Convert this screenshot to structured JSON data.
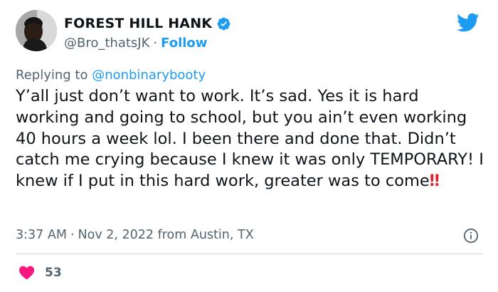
{
  "tweet": {
    "author": {
      "display_name": "FOREST HILL HANK",
      "handle": "@Bro_thatsJK",
      "follow_label": "Follow",
      "separator": "·"
    },
    "reply_prefix": "Replying to",
    "reply_mention": "@nonbinarybooty",
    "text": "Y’all just don’t want to work. It’s sad. Yes it is hard working and going to school, but you ain’t even working 40 hours a week lol. I been there and done that. Didn’t catch me crying because I knew it was only TEMPORARY! I knew if I put in this hard work, greater was to come",
    "text_emoji": "‼",
    "time": "3:37 AM",
    "date_location": "Nov 2, 2022 from Austin, TX",
    "likes": "53"
  },
  "icons": {
    "verified": "verified-badge-icon",
    "brand": "twitter-bird-icon",
    "info": "info-icon",
    "like": "heart-icon"
  },
  "colors": {
    "accent": "#1d9bf0",
    "like": "#f91880",
    "muted": "#536471",
    "text": "#0f1419"
  }
}
